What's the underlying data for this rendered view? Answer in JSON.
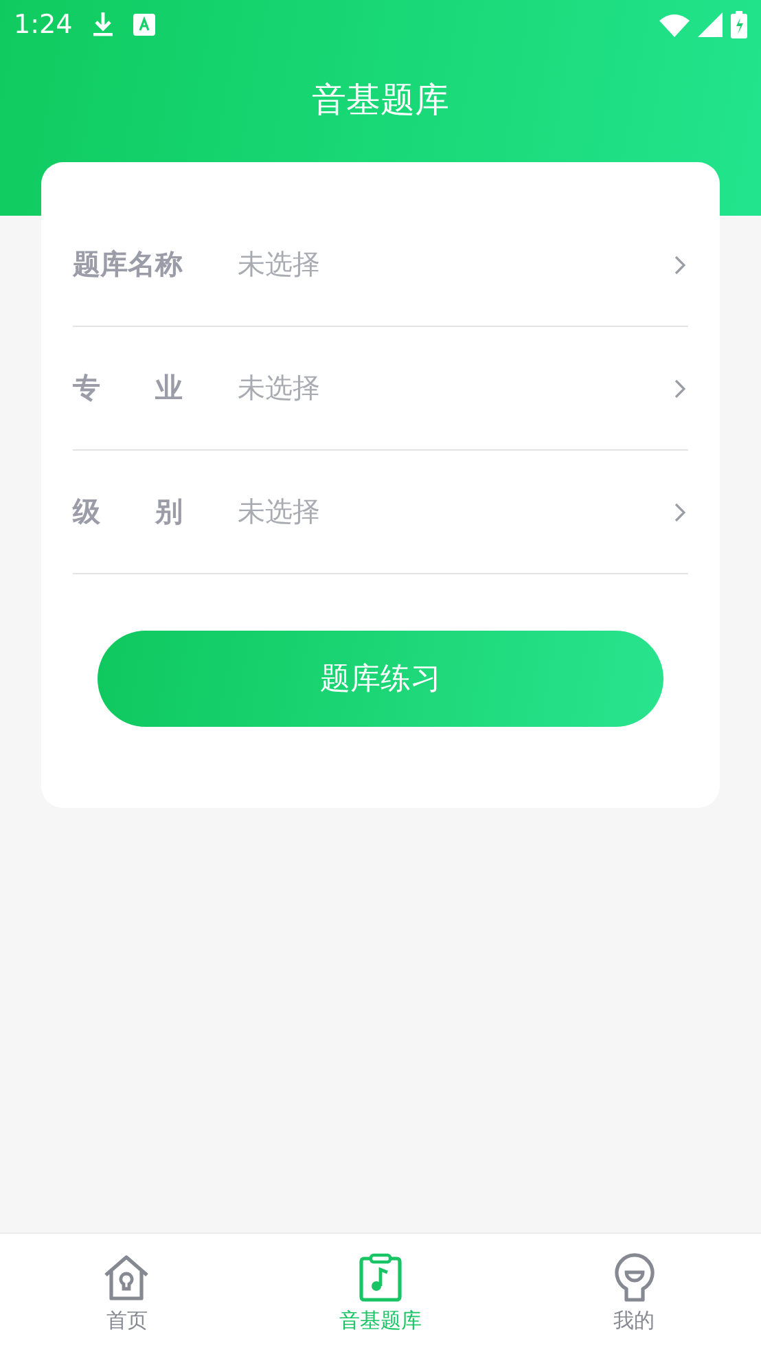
{
  "status_bar": {
    "time": "1:24"
  },
  "title": "音基题库",
  "form": {
    "rows": [
      {
        "label": "题库名称",
        "placeholder": "未选择"
      },
      {
        "label": "专业",
        "placeholder": "未选择"
      },
      {
        "label": "级别",
        "placeholder": "未选择"
      }
    ],
    "button": "题库练习"
  },
  "tabs": [
    {
      "label": "首页",
      "kind": "home",
      "selected": false
    },
    {
      "label": "音基题库",
      "kind": "music",
      "selected": true
    },
    {
      "label": "我的",
      "kind": "user",
      "selected": false
    }
  ]
}
